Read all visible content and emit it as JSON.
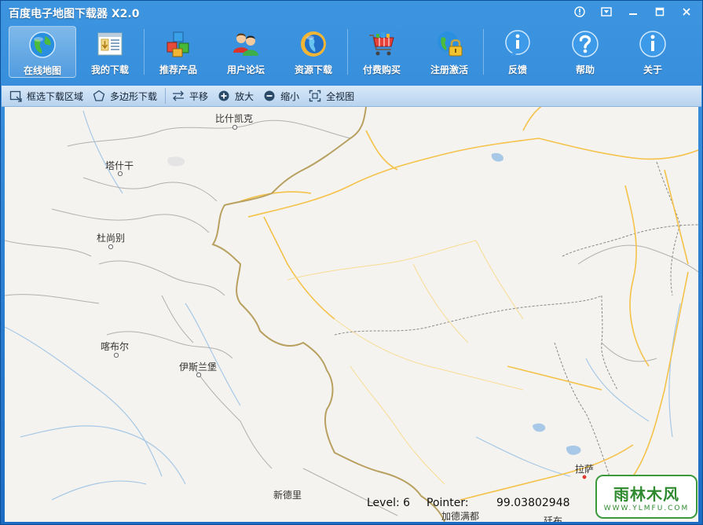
{
  "window": {
    "title": "百度电子地图下载器 X2.0"
  },
  "title_buttons": [
    "info",
    "menu",
    "minimize",
    "maximize",
    "close"
  ],
  "toolbar": [
    {
      "id": "online-map",
      "label": "在线地图",
      "icon": "globe-icon",
      "active": true
    },
    {
      "id": "my-downloads",
      "label": "我的下载",
      "icon": "download-list-icon"
    },
    {
      "id": "recommend",
      "label": "推荐产品",
      "icon": "cubes-icon"
    },
    {
      "id": "forum",
      "label": "用户论坛",
      "icon": "users-icon"
    },
    {
      "id": "resource-download",
      "label": "资源下载",
      "icon": "resource-globe-icon"
    },
    {
      "id": "purchase",
      "label": "付费购买",
      "icon": "cart-icon"
    },
    {
      "id": "register",
      "label": "注册激活",
      "icon": "lock-globe-icon"
    },
    {
      "id": "feedback",
      "label": "反馈",
      "icon": "feedback-info-icon"
    },
    {
      "id": "help",
      "label": "帮助",
      "icon": "help-icon"
    },
    {
      "id": "about",
      "label": "关于",
      "icon": "about-info-icon"
    }
  ],
  "subtoolbar": [
    {
      "id": "rect-select",
      "label": "框选下载区域",
      "icon": "rect-select-icon"
    },
    {
      "id": "polygon",
      "label": "多边形下载",
      "icon": "polygon-icon"
    },
    {
      "id": "pan",
      "label": "平移",
      "icon": "pan-icon"
    },
    {
      "id": "zoom-in",
      "label": "放大",
      "icon": "zoom-in-icon"
    },
    {
      "id": "zoom-out",
      "label": "缩小",
      "icon": "zoom-out-icon"
    },
    {
      "id": "full-view",
      "label": "全视图",
      "icon": "full-view-icon"
    }
  ],
  "map": {
    "cities": [
      {
        "name": "比什凯克"
      },
      {
        "name": "塔什干"
      },
      {
        "name": "杜尚别"
      },
      {
        "name": "喀布尔"
      },
      {
        "name": "伊斯兰堡"
      },
      {
        "name": "新德里"
      },
      {
        "name": "拉萨"
      },
      {
        "name": "加德满都"
      },
      {
        "name": "廷布"
      }
    ],
    "status": {
      "level_label": "Level: 6",
      "pointer_label": "Pointer:",
      "pointer_value": "99.03802948"
    }
  },
  "watermark": {
    "main": "雨林木风",
    "sub": "WWW.YLMFU.COM"
  },
  "colors": {
    "title_bar": "#2a80d6",
    "map_bg": "#f4f3ef",
    "border_line": "#b8a060",
    "road": "#f5c24a"
  }
}
